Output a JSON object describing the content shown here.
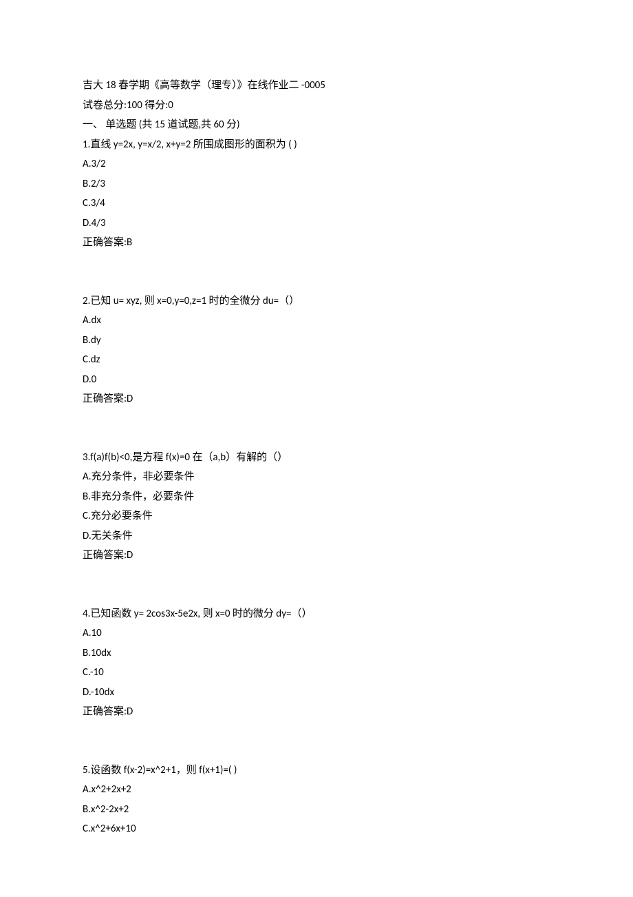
{
  "header": {
    "title_line": "吉大 18 春学期《高等数学（理专）》在线作业二   -0005",
    "score_line": "试卷总分:100      得分:0",
    "section_line": "一、  单选题 (共  15  道试题,共  60  分)"
  },
  "questions": [
    {
      "stem": "1.直线  y=2x, y=x/2, x+y=2  所围成图形的面积为  ( )",
      "options": [
        "A.3/2",
        "B.2/3",
        "C.3/4",
        "D.4/3"
      ],
      "answer": "正确答案:B"
    },
    {
      "stem": "2.已知 u= xyz,  则 x=0,y=0,z=1 时的全微分 du=（）",
      "options": [
        "A.dx",
        "B.dy",
        "C.dz",
        "D.0"
      ],
      "answer": "正确答案:D"
    },
    {
      "stem": "3.f(a)f(b)<0,是方程 f(x)=0 在（a,b）有解的（）",
      "options": [
        "A.充分条件，非必要条件",
        "B.非充分条件，必要条件",
        "C.充分必要条件",
        "D.无关条件"
      ],
      "answer": "正确答案:D"
    },
    {
      "stem": "4.已知函数 y= 2cos3x-5e2x,  则 x=0 时的微分 dy=（）",
      "options": [
        "A.10",
        "B.10dx",
        "C.-10",
        "D.-10dx"
      ],
      "answer": "正确答案:D"
    },
    {
      "stem": "5.设函数 f(x-2)=x^2+1，则 f(x+1)=( )",
      "options": [
        "A.x^2+2x+2",
        "B.x^2-2x+2",
        "C.x^2+6x+10"
      ],
      "answer": ""
    }
  ]
}
